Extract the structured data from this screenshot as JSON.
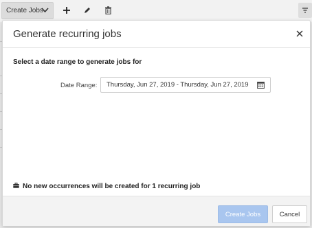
{
  "toolbar": {
    "create_jobs_label": "Create Jobs",
    "icons": [
      "chevron-down-icon",
      "plus-icon",
      "pencil-icon",
      "trash-icon",
      "filter-icon"
    ]
  },
  "dialog": {
    "title": "Generate recurring jobs",
    "section_heading": "Select a date range to generate jobs for",
    "date_range_label": "Date Range:",
    "date_range_value": "Thursday, Jun 27, 2019 - Thursday, Jun 27, 2019",
    "notice": "No new occurrences will be created for 1 recurring job",
    "create_button": "Create Jobs",
    "cancel_button": "Cancel"
  },
  "colors": {
    "primary_disabled": "#a9c6ef",
    "footer_bg": "#f3f3f3",
    "toolbar_bg": "#f2f2f2"
  }
}
